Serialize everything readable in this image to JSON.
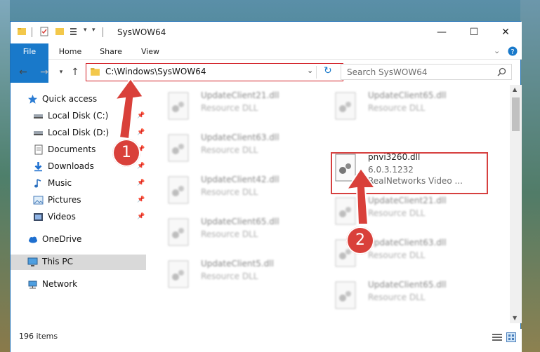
{
  "window": {
    "title": "SysWOW64",
    "controls": {
      "minimize": "—",
      "maximize": "☐",
      "close": "✕"
    }
  },
  "ribbon": {
    "tabs": [
      {
        "label": "File"
      },
      {
        "label": "Home"
      },
      {
        "label": "Share"
      },
      {
        "label": "View"
      }
    ]
  },
  "navbar": {
    "address": "C:\\Windows\\SysWOW64",
    "search_placeholder": "Search SysWOW64"
  },
  "sidebar": {
    "items": [
      {
        "label": "Quick access",
        "icon": "star-icon"
      },
      {
        "label": "Local Disk (C:)",
        "icon": "drive-icon"
      },
      {
        "label": "Local Disk (D:)",
        "icon": "drive-icon"
      },
      {
        "label": "Documents",
        "icon": "documents-icon"
      },
      {
        "label": "Downloads",
        "icon": "downloads-icon"
      },
      {
        "label": "Music",
        "icon": "music-icon"
      },
      {
        "label": "Pictures",
        "icon": "pictures-icon"
      },
      {
        "label": "Videos",
        "icon": "videos-icon"
      },
      {
        "label": "OneDrive",
        "icon": "cloud-icon"
      },
      {
        "label": "This PC",
        "icon": "pc-icon"
      },
      {
        "label": "Network",
        "icon": "network-icon"
      }
    ]
  },
  "files": [
    {
      "name": "UpdateClient21.dll",
      "type": "Resource DLL"
    },
    {
      "name": "UpdateClient65.dll",
      "type": "Resource DLL"
    },
    {
      "name": "UpdateClient63.dll",
      "type": "Resource DLL"
    },
    {
      "name": "pnvi3260.dll",
      "version": "6.0.3.1232",
      "desc": "RealNetworks Video ..."
    },
    {
      "name": "UpdateClient42.dll",
      "type": "Resource DLL"
    },
    {
      "name": "UpdateClient21.dll",
      "type": "Resource DLL"
    },
    {
      "name": "UpdateClient65.dll",
      "type": "Resource DLL"
    },
    {
      "name": "UpdateClient63.dll",
      "type": "Resource DLL"
    },
    {
      "name": "UpdateClient5.dll",
      "type": "Resource DLL"
    },
    {
      "name": "UpdateClient65.dll",
      "type": "Resource DLL"
    }
  ],
  "status": {
    "item_count": "196 items"
  },
  "annotations": {
    "step1": "1",
    "step2": "2",
    "color": "#d9403a"
  }
}
